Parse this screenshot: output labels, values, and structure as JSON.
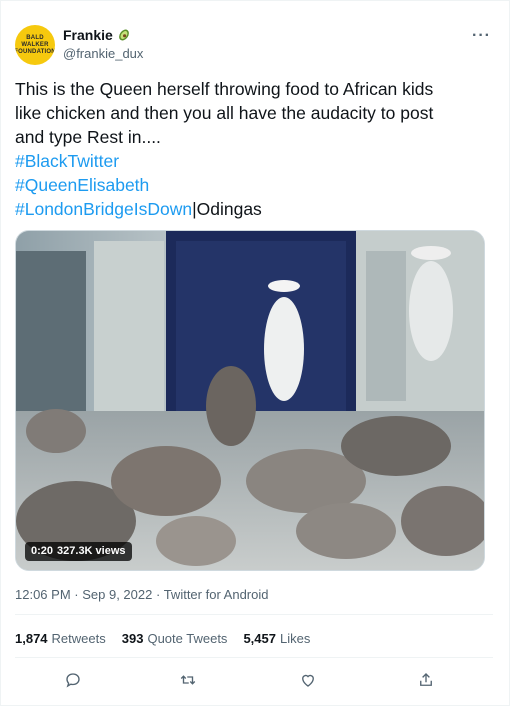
{
  "author": {
    "display_name": "Frankie",
    "handle": "@frankie_dux",
    "avatar_text": "BALD WALKER FOUNDATION",
    "badge_icon": "avocado-icon"
  },
  "tweet": {
    "text_lines": [
      "This is the Queen herself throwing food to African kids",
      "like chicken and then you all have the audacity to post",
      "and type Rest in...."
    ],
    "hashtags": [
      "#BlackTwitter",
      "#QueenElisabeth",
      "#LondonBridgeIsDown"
    ],
    "trailing_text": "|Odingas"
  },
  "media": {
    "duration": "0:20",
    "views": "327.3K views"
  },
  "meta": {
    "time": "12:06 PM",
    "date": "Sep 9, 2022",
    "source": "Twitter for Android"
  },
  "stats": {
    "retweets_count": "1,874",
    "retweets_label": "Retweets",
    "quotes_count": "393",
    "quotes_label": "Quote Tweets",
    "likes_count": "5,457",
    "likes_label": "Likes"
  },
  "colors": {
    "link": "#1d9bf0",
    "secondary_text": "#536471",
    "primary_text": "#0f1419"
  },
  "icons": {
    "more": "more-icon",
    "reply": "reply-icon",
    "retweet": "retweet-icon",
    "like": "heart-icon",
    "share": "share-icon"
  }
}
